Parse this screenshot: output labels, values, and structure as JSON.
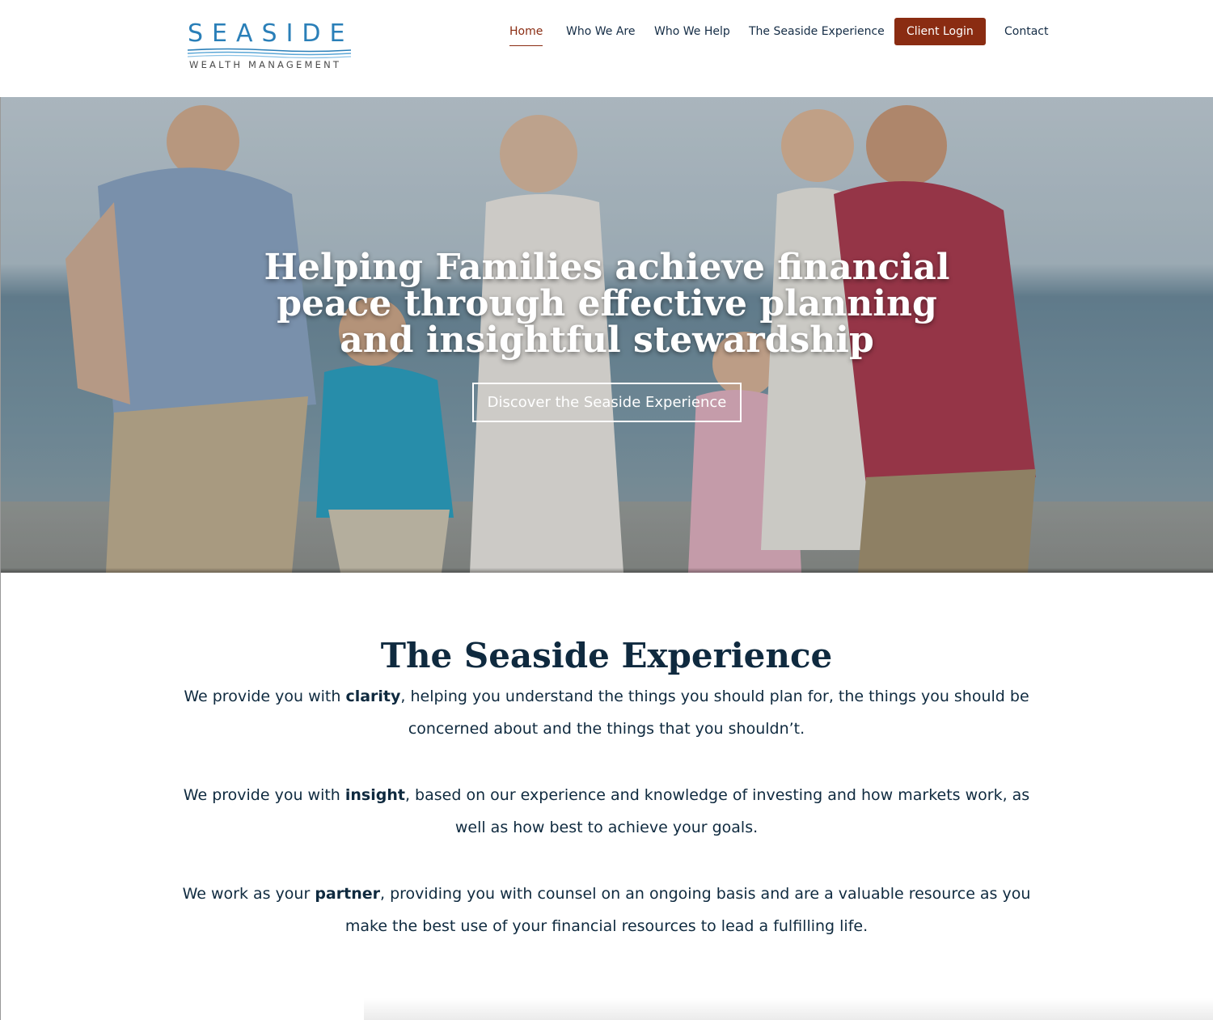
{
  "brand": {
    "name": "SEASIDE",
    "tagline": "WEALTH MANAGEMENT",
    "primary_color": "#2a7fb8",
    "accent_color": "#8a2c12",
    "text_color": "#0f2a3f"
  },
  "nav": {
    "items": [
      {
        "label": "Home",
        "active": true
      },
      {
        "label": "Who We Are"
      },
      {
        "label": "Who We Help"
      },
      {
        "label": "The Seaside Experience"
      },
      {
        "label": "Client Login",
        "highlight": true
      },
      {
        "label": "Contact"
      }
    ]
  },
  "hero": {
    "title": "Helping Families achieve financial peace through effective planning and insightful stewardship",
    "cta_label": "Discover the Seaside Experience",
    "image": "family-walking-on-beach-photo"
  },
  "experience": {
    "title": "The Seaside Experience",
    "paragraphs": [
      {
        "before": "We provide you with ",
        "bold": "clarity",
        "after": ", helping you understand the things  you should plan for, the things you should be concerned about and the things that you shouldn’t."
      },
      {
        "before": "We provide you with ",
        "bold": "insight",
        "after": ", based on our experience and knowledge of investing and how markets work, as well as how best to achieve your goals."
      },
      {
        "before": "We work as your ",
        "bold": "partner",
        "after": ", providing you with counsel on an ongoing basis and are a valuable resource as you make the best use of your financial resources to lead a fulfilling life."
      }
    ]
  }
}
